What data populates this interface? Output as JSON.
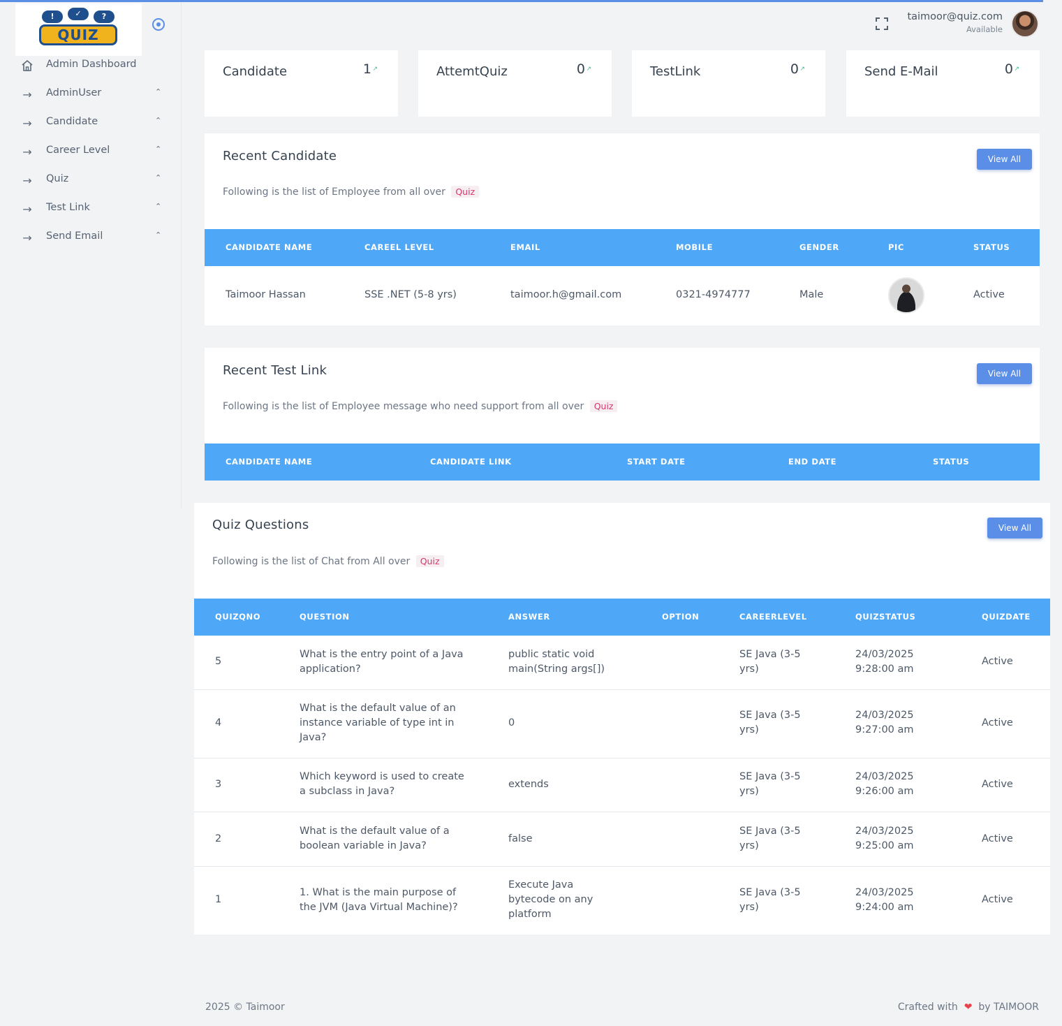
{
  "brand": {
    "logo_text": "QUIZ",
    "logo_bubbles": [
      "!",
      "✓",
      "?"
    ]
  },
  "sidebar": {
    "items": [
      {
        "label": "Admin Dashboard",
        "icon": "home-icon"
      },
      {
        "label": "AdminUser",
        "icon": "arrow-right-icon"
      },
      {
        "label": "Candidate",
        "icon": "arrow-right-icon"
      },
      {
        "label": "Career Level",
        "icon": "arrow-right-icon"
      },
      {
        "label": "Quiz",
        "icon": "arrow-right-icon"
      },
      {
        "label": "Test Link",
        "icon": "arrow-right-icon"
      },
      {
        "label": "Send Email",
        "icon": "arrow-right-icon"
      }
    ]
  },
  "header": {
    "email": "taimoor@quiz.com",
    "status": "Available"
  },
  "stats": [
    {
      "title": "Candidate",
      "value": "1"
    },
    {
      "title": "AttemtQuiz",
      "value": "0"
    },
    {
      "title": "TestLink",
      "value": "0"
    },
    {
      "title": "Send E-Mail",
      "value": "0"
    }
  ],
  "recent_candidate": {
    "title": "Recent Candidate",
    "subtitle": "Following is the list of Employee from all over",
    "tag": "Quiz",
    "button": "View All",
    "columns": [
      "CANDIDATE NAME",
      "CAREEL LEVEL",
      "EMAIL",
      "MOBILE",
      "GENDER",
      "PIC",
      "STATUS"
    ],
    "rows": [
      {
        "name": "Taimoor Hassan",
        "level": "SSE .NET (5-8 yrs)",
        "email": "taimoor.h@gmail.com",
        "mobile": "0321-4974777",
        "gender": "Male",
        "status": "Active"
      }
    ]
  },
  "recent_test_link": {
    "title": "Recent Test Link",
    "subtitle": "Following is the list of Employee message who need support from all over",
    "tag": "Quiz",
    "button": "View All",
    "columns": [
      "CANDIDATE NAME",
      "CANDIDATE LINK",
      "START DATE",
      "END DATE",
      "STATUS"
    ]
  },
  "quiz_questions": {
    "title": "Quiz Questions",
    "subtitle": "Following is the list of Chat from All over",
    "tag": "Quiz",
    "button": "View All",
    "columns": [
      "QUIZQNO",
      "QUESTION",
      "ANSWER",
      "OPTION",
      "CAREERLEVEL",
      "QUIZSTATUS",
      "QUIZDATE"
    ],
    "rows": [
      {
        "no": "5",
        "q1": "What is the entry point of a Java",
        "q2": "application?",
        "q3": "",
        "a1": "public static void",
        "a2": "main(String args[])",
        "a3": "",
        "c1": "SE Java (3-5",
        "c2": "yrs)",
        "d1": "24/03/2025",
        "d2": "9:28:00 am",
        "status": "Active"
      },
      {
        "no": "4",
        "q1": "What is the default value of an",
        "q2": "instance variable of type int in",
        "q3": "Java?",
        "a1": "0",
        "a2": "",
        "a3": "",
        "c1": "SE Java (3-5",
        "c2": "yrs)",
        "d1": "24/03/2025",
        "d2": "9:27:00 am",
        "status": "Active"
      },
      {
        "no": "3",
        "q1": "Which keyword is used to create",
        "q2": "a subclass in Java?",
        "q3": "",
        "a1": "extends",
        "a2": "",
        "a3": "",
        "c1": "SE Java (3-5",
        "c2": "yrs)",
        "d1": "24/03/2025",
        "d2": "9:26:00 am",
        "status": "Active"
      },
      {
        "no": "2",
        "q1": "What is the default value of a",
        "q2": "boolean variable in Java?",
        "q3": "",
        "a1": "false",
        "a2": "",
        "a3": "",
        "c1": "SE Java (3-5",
        "c2": "yrs)",
        "d1": "24/03/2025",
        "d2": "9:25:00 am",
        "status": "Active"
      },
      {
        "no": "1",
        "q1": "1. What is the main purpose of",
        "q2": "the JVM (Java Virtual Machine)?",
        "q3": "",
        "a1": "Execute Java",
        "a2": "bytecode on any",
        "a3": "platform",
        "c1": "SE Java (3-5",
        "c2": "yrs)",
        "d1": "24/03/2025",
        "d2": "9:24:00 am",
        "status": "Active"
      }
    ]
  },
  "footer": {
    "left": "2025 © Taimoor",
    "crafted": "Crafted with",
    "by": "by TAIMOOR"
  },
  "colors": {
    "accent": "#5b8ee6",
    "table_header": "#4fa7f7",
    "tag_text": "#d4386e",
    "trend": "#3cbf8a",
    "heart": "#e8434c"
  }
}
